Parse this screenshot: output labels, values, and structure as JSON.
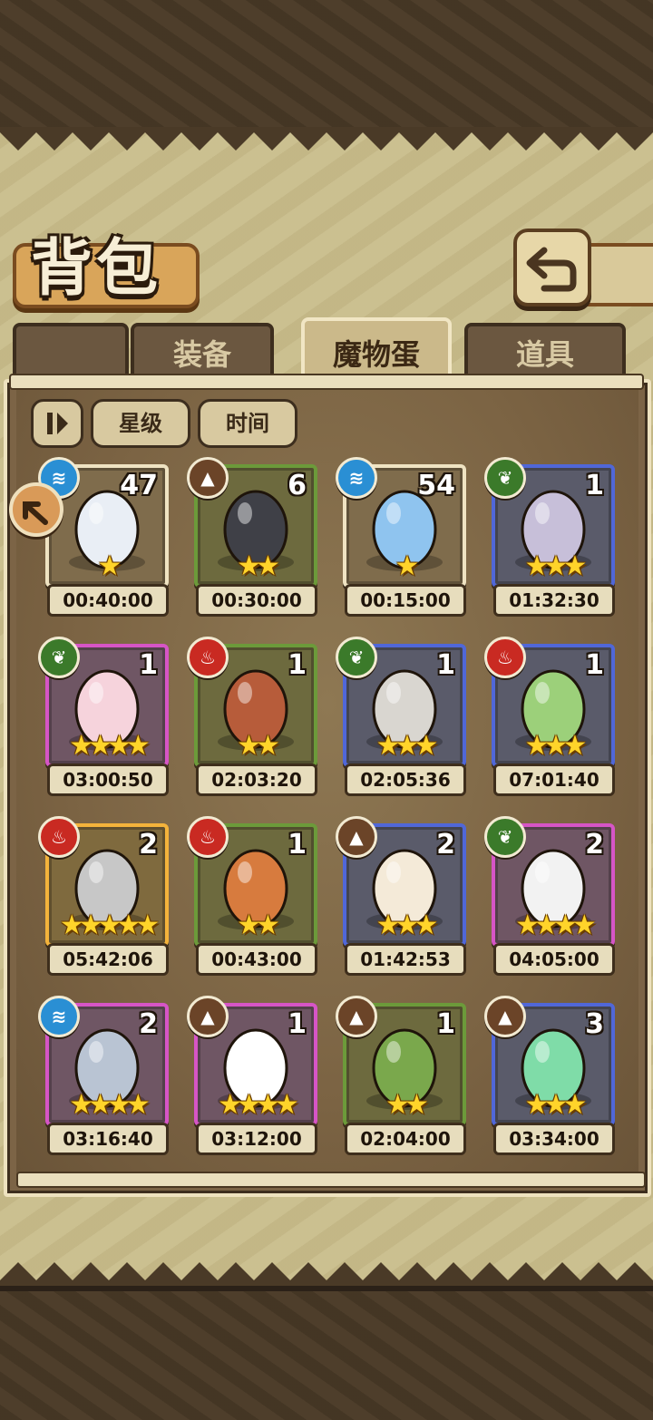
{
  "header": {
    "title": "背包"
  },
  "tabs": [
    {
      "label": "装备",
      "active": false
    },
    {
      "label": "魔物蛋",
      "active": true
    },
    {
      "label": "道具",
      "active": false
    }
  ],
  "sort": {
    "star_label": "星级",
    "time_label": "时间"
  },
  "icons": {
    "back": "back-arrow-icon",
    "sort_toggle": "sort-order-icon",
    "side_badge": "collapse-arrow-icon"
  },
  "eggs": [
    {
      "element": "water",
      "count": "47",
      "stars": 1,
      "timer": "00:40:00",
      "rarity": "white"
    },
    {
      "element": "earth",
      "count": "6",
      "stars": 2,
      "timer": "00:30:00",
      "rarity": "green"
    },
    {
      "element": "water",
      "count": "54",
      "stars": 1,
      "timer": "00:15:00",
      "rarity": "white"
    },
    {
      "element": "leaf",
      "count": "1",
      "stars": 3,
      "timer": "01:32:30",
      "rarity": "blue"
    },
    {
      "element": "leaf",
      "count": "1",
      "stars": 4,
      "timer": "03:00:50",
      "rarity": "purple"
    },
    {
      "element": "fire",
      "count": "1",
      "stars": 2,
      "timer": "02:03:20",
      "rarity": "green"
    },
    {
      "element": "leaf",
      "count": "1",
      "stars": 3,
      "timer": "02:05:36",
      "rarity": "blue"
    },
    {
      "element": "fire",
      "count": "1",
      "stars": 3,
      "timer": "07:01:40",
      "rarity": "blue"
    },
    {
      "element": "fire",
      "count": "2",
      "stars": 5,
      "timer": "05:42:06",
      "rarity": "orange"
    },
    {
      "element": "fire",
      "count": "1",
      "stars": 2,
      "timer": "00:43:00",
      "rarity": "green"
    },
    {
      "element": "earth",
      "count": "2",
      "stars": 3,
      "timer": "01:42:53",
      "rarity": "blue"
    },
    {
      "element": "leaf",
      "count": "2",
      "stars": 4,
      "timer": "04:05:00",
      "rarity": "purple"
    },
    {
      "element": "water",
      "count": "2",
      "stars": 4,
      "timer": "03:16:40",
      "rarity": "purple"
    },
    {
      "element": "earth",
      "count": "1",
      "stars": 4,
      "timer": "03:12:00",
      "rarity": "purple"
    },
    {
      "element": "earth",
      "count": "1",
      "stars": 2,
      "timer": "02:04:00",
      "rarity": "green"
    },
    {
      "element": "earth",
      "count": "3",
      "stars": 3,
      "timer": "03:34:00",
      "rarity": "blue"
    }
  ],
  "colors": {
    "water": "#2a8fd4",
    "earth": "#6b4428",
    "leaf": "#3b7a2a",
    "fire": "#c92a22",
    "white": "#efe3c2",
    "green": "#6c9a3a",
    "blue": "#5067d8",
    "purple": "#d655c6",
    "orange": "#f4b33b",
    "star": "#ffd42a"
  }
}
